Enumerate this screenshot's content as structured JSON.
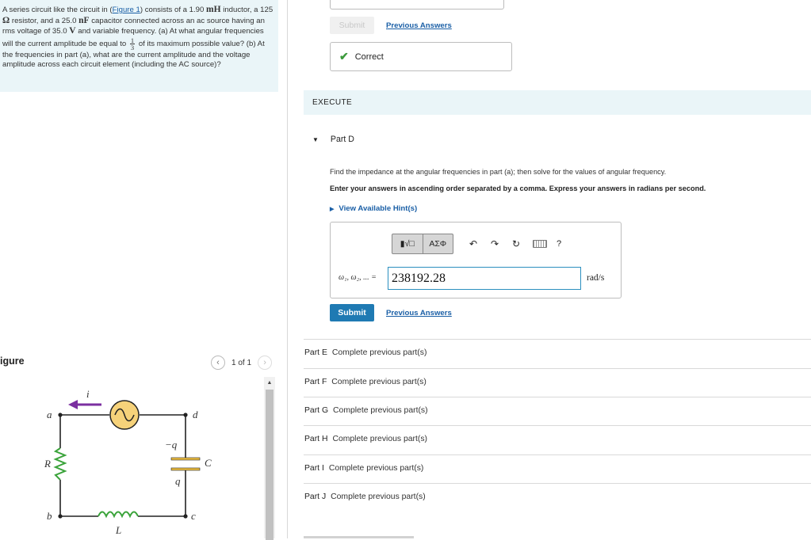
{
  "problem": {
    "t1": "A series circuit like the circuit in (",
    "link": "Figure 1",
    "t2": ") consists of a 1.90 ",
    "m1": "mH",
    "t3": "inductor, a 125 ",
    "m2": "Ω",
    "t4": " resistor, and a 25.0 ",
    "m3": "nF",
    "t5": " capacitor connected across an ac source having an rms voltage of 35.0 ",
    "m4": "V",
    "t6": " and variable frequency. (a) At what angular frequencies will the current amplitude be equal to ",
    "frac_num": "1",
    "frac_den": "3",
    "t7": " of its maximum possible value? (b) At the frequencies in part (a), what are the current amplitude and the voltage amplitude across each circuit element (including the AC source)?"
  },
  "figure": {
    "title": "igure",
    "pager_text": "1 of 1",
    "labels": {
      "a": "a",
      "b": "b",
      "c": "c",
      "d": "d",
      "i": "i",
      "R": "R",
      "L": "L",
      "C": "C",
      "minus_q": "−q",
      "q": "q"
    },
    "colors": {
      "wire": "#222222",
      "source_fill": "#f6d27a",
      "arrow": "#7b2fa0",
      "resistor": "#3aa33a",
      "inductor": "#3aa33a",
      "cap_plate": "#f0c040"
    }
  },
  "prev_part": {
    "submit_label": "Submit",
    "prev_answers_label": "Previous Answers",
    "correct_label": "Correct"
  },
  "execute_label": "EXECUTE",
  "part_d": {
    "title": "Part D",
    "instruction": "Find the impedance at the angular frequencies in part (a); then solve for the values of angular frequency.",
    "instruction_bold": "Enter your answers in ascending order separated by a comma. Express your answers in radians per second.",
    "hint_label": "View Available Hint(s)",
    "toolbar": {
      "template1": "▮√□",
      "template2": "ΑΣΦ",
      "icons": [
        "undo-icon",
        "redo-icon",
        "reset-icon",
        "keyboard-icon",
        "help-icon"
      ],
      "help": "?"
    },
    "omega_label": "ω₁, ω₂, ... =",
    "answer_value": "238192.28",
    "unit": "rad/s",
    "submit_label": "Submit",
    "prev_answers_label": "Previous Answers"
  },
  "other_parts": [
    {
      "name": "Part E",
      "status": "Complete previous part(s)"
    },
    {
      "name": "Part F",
      "status": "Complete previous part(s)"
    },
    {
      "name": "Part G",
      "status": "Complete previous part(s)"
    },
    {
      "name": "Part H",
      "status": "Complete previous part(s)"
    },
    {
      "name": "Part I",
      "status": "Complete previous part(s)"
    },
    {
      "name": "Part J",
      "status": "Complete previous part(s)"
    }
  ],
  "colors": {
    "accent": "#1f7ab3",
    "link": "#1a5fa6",
    "panel_bg": "#eaf5f8",
    "correct": "#3c9a3c"
  }
}
